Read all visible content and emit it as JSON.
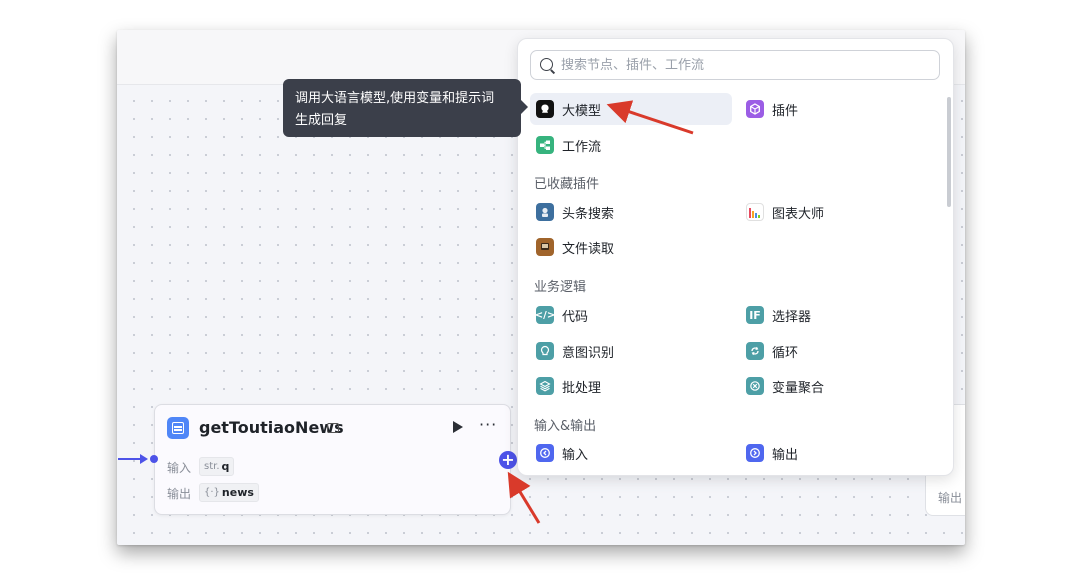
{
  "search": {
    "placeholder": "搜索节点、插件、工作流"
  },
  "tooltip": {
    "text_line1": "调用大语言模型,使用变量和提示词",
    "text_line2": "生成回复"
  },
  "menu": {
    "top_items": [
      {
        "label": "大模型",
        "icon": "llm-icon",
        "color": "#111111"
      },
      {
        "label": "插件",
        "icon": "plugin-icon",
        "color": "#9b5de5"
      },
      {
        "label": "工作流",
        "icon": "workflow-icon",
        "color": "#36b37e"
      }
    ],
    "sections": [
      {
        "title": "已收藏插件",
        "items": [
          {
            "label": "头条搜索",
            "icon": "toutiao-search-icon"
          },
          {
            "label": "图表大师",
            "icon": "chart-master-icon"
          },
          {
            "label": "文件读取",
            "icon": "file-reader-icon"
          }
        ]
      },
      {
        "title": "业务逻辑",
        "items": [
          {
            "label": "代码",
            "icon": "code-icon"
          },
          {
            "label": "选择器",
            "icon": "if-selector-icon"
          },
          {
            "label": "意图识别",
            "icon": "intent-icon"
          },
          {
            "label": "循环",
            "icon": "loop-icon"
          },
          {
            "label": "批处理",
            "icon": "batch-icon"
          },
          {
            "label": "变量聚合",
            "icon": "variable-merge-icon"
          }
        ]
      },
      {
        "title": "输入&输出",
        "items": [
          {
            "label": "输入",
            "icon": "input-icon"
          },
          {
            "label": "输出",
            "icon": "output-icon"
          }
        ]
      }
    ],
    "accent_color": "#4d9fa6"
  },
  "node": {
    "title": "getToutiaoNews",
    "input_label": "输入",
    "input_type": "str.",
    "input_name": "q",
    "output_label": "输出",
    "output_type": "{·}",
    "output_name": "news"
  },
  "right_node": {
    "output_label": "输出"
  },
  "annotation_color": "#d93a2b"
}
